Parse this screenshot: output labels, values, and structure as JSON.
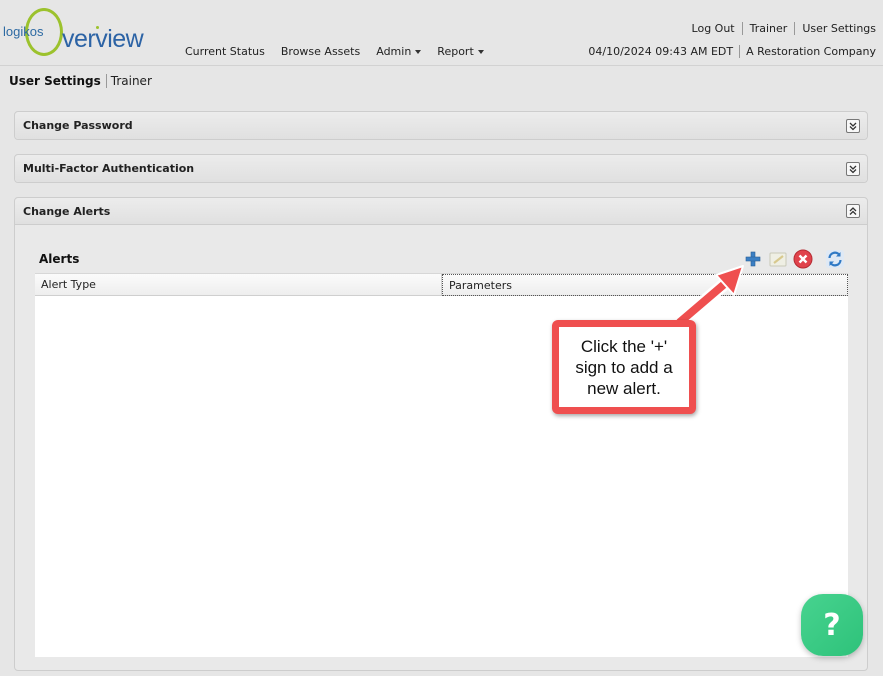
{
  "brand": {
    "logo_small": "logikos",
    "logo_big": "verview"
  },
  "nav": [
    {
      "label": "Current Status",
      "dropdown": false
    },
    {
      "label": "Browse Assets",
      "dropdown": false
    },
    {
      "label": "Admin",
      "dropdown": true
    },
    {
      "label": "Report",
      "dropdown": true
    }
  ],
  "top_links": [
    "Log Out",
    "Trainer",
    "User Settings"
  ],
  "status": {
    "datetime": "04/10/2024 09:43 AM EDT",
    "company": "A Restoration Company"
  },
  "breadcrumb": {
    "current": "User Settings",
    "sub": "Trainer"
  },
  "panels": {
    "change_password": "Change Password",
    "mfa": "Multi-Factor Authentication",
    "change_alerts": "Change Alerts"
  },
  "alerts": {
    "title": "Alerts",
    "columns": [
      "Alert Type",
      "Parameters"
    ],
    "icons": [
      "add-icon",
      "edit-icon",
      "delete-icon",
      "refresh-icon"
    ]
  },
  "callout": {
    "text": "Click the '+' sign to add a new alert."
  },
  "help": {
    "label": "?"
  },
  "colors": {
    "accent_blue": "#2c63a5",
    "logo_green": "#9cc22d",
    "callout_red": "#ef4f4f",
    "help_green": "#3ccb85"
  }
}
